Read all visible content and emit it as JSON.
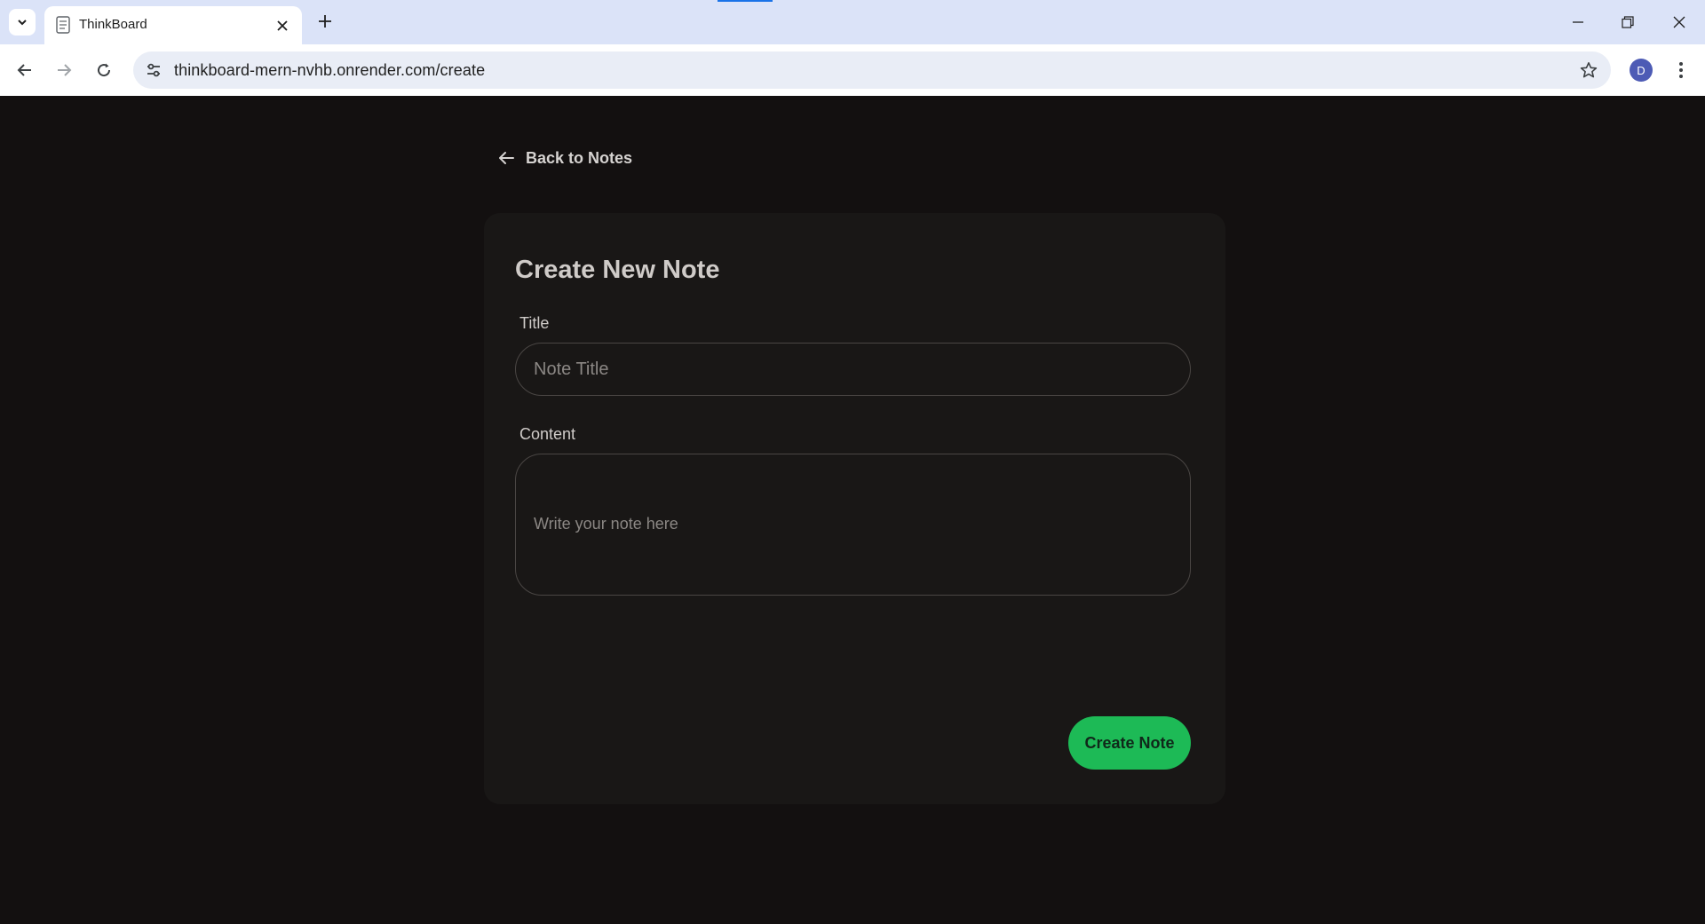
{
  "browser": {
    "tab_title": "ThinkBoard",
    "url": "thinkboard-mern-nvhb.onrender.com/create",
    "profile_initial": "D",
    "icons": [
      "tab-search-icon",
      "document-icon",
      "close-icon",
      "plus-icon",
      "minimize-icon",
      "restore-icon",
      "close-window-icon",
      "back-arrow-icon",
      "forward-arrow-icon",
      "reload-icon",
      "site-info-icon",
      "star-icon",
      "kebab-menu-icon"
    ]
  },
  "page": {
    "back_link_label": "Back to Notes",
    "form": {
      "heading": "Create New Note",
      "title_label": "Title",
      "title_placeholder": "Note Title",
      "title_value": "",
      "content_label": "Content",
      "content_placeholder": "Write your note here",
      "content_value": "",
      "submit_label": "Create Note"
    }
  },
  "colors": {
    "page_bg": "#131010",
    "card_bg": "#191716",
    "accent": "#1dba56",
    "tabstrip_bg": "#dbe3f8"
  }
}
